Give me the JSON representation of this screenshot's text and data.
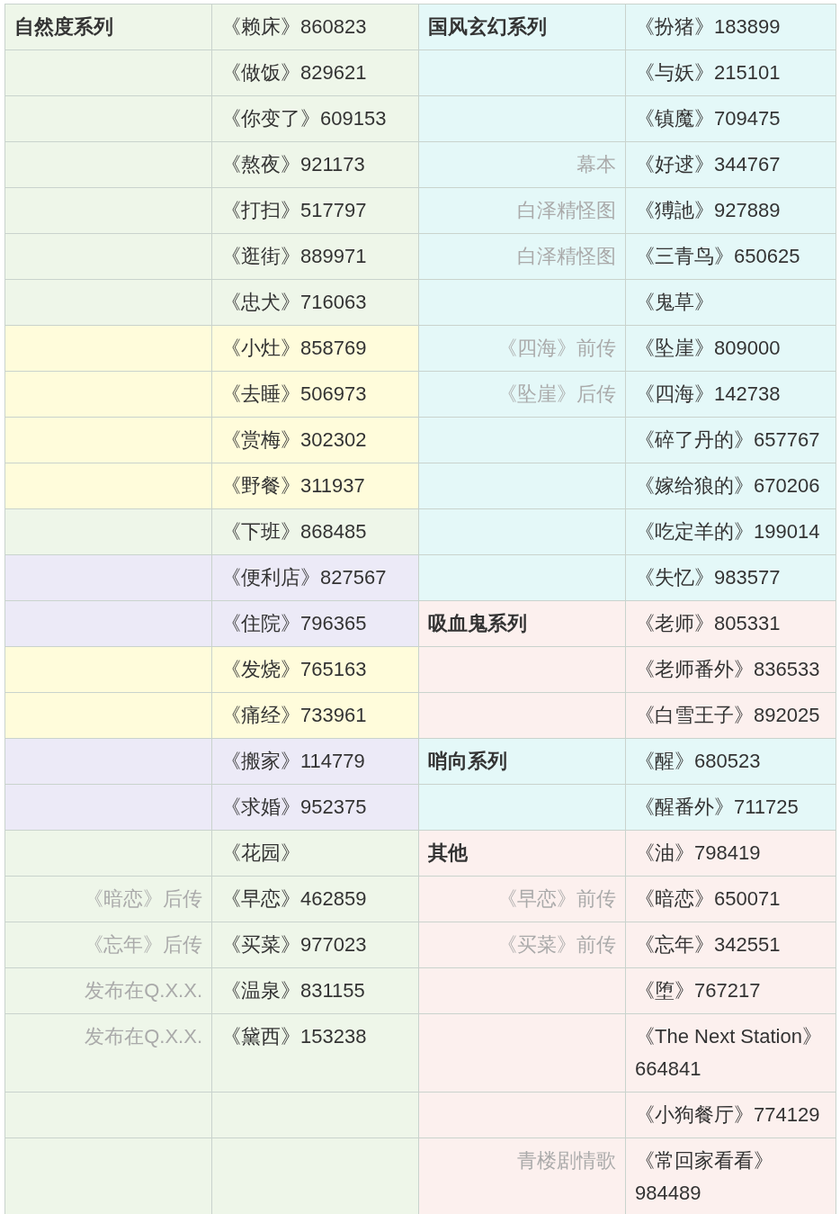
{
  "rows": [
    {
      "left": {
        "color": "#eef6e9",
        "label": {
          "text": "自然度系列",
          "kind": "series"
        },
        "title": "《赖床》860823"
      },
      "right": {
        "color": "#e4f8f8",
        "label": {
          "text": "国风玄幻系列",
          "kind": "series"
        },
        "title": "《扮猪》183899"
      }
    },
    {
      "left": {
        "color": "#eef6e9",
        "title": "《做饭》829621"
      },
      "right": {
        "color": "#e4f8f8",
        "title": "《与妖》215101"
      }
    },
    {
      "left": {
        "color": "#eef6e9",
        "title": "《你变了》609153"
      },
      "right": {
        "color": "#e4f8f8",
        "title": "《镇魔》709475"
      }
    },
    {
      "left": {
        "color": "#eef6e9",
        "title": "《熬夜》921173"
      },
      "right": {
        "color": "#e4f8f8",
        "label": {
          "text": "幕本",
          "kind": "note"
        },
        "title": "《好逑》344767"
      }
    },
    {
      "left": {
        "color": "#eef6e9",
        "title": "《打扫》517797"
      },
      "right": {
        "color": "#e4f8f8",
        "label": {
          "text": "白泽精怪图",
          "kind": "note"
        },
        "title": "《猼訑》927889"
      }
    },
    {
      "left": {
        "color": "#eef6e9",
        "title": "《逛街》889971"
      },
      "right": {
        "color": "#e4f8f8",
        "label": {
          "text": "白泽精怪图",
          "kind": "note"
        },
        "title": "《三青鸟》650625"
      }
    },
    {
      "left": {
        "color": "#eef6e9",
        "title": "《忠犬》716063"
      },
      "right": {
        "color": "#e4f8f8",
        "title": "《鬼草》"
      }
    },
    {
      "left": {
        "color": "#fffcdb",
        "title": "《小灶》858769"
      },
      "right": {
        "color": "#e4f8f8",
        "label": {
          "text": "《四海》前传",
          "kind": "note"
        },
        "title": "《坠崖》809000"
      }
    },
    {
      "left": {
        "color": "#fffcdb",
        "title": "《去睡》506973"
      },
      "right": {
        "color": "#e4f8f8",
        "label": {
          "text": "《坠崖》后传",
          "kind": "note"
        },
        "title": "《四海》142738"
      }
    },
    {
      "left": {
        "color": "#fffcdb",
        "title": "《赏梅》302302"
      },
      "right": {
        "color": "#e4f8f8",
        "title": "《碎了丹的》657767"
      }
    },
    {
      "left": {
        "color": "#fffcdb",
        "title": "《野餐》311937"
      },
      "right": {
        "color": "#e4f8f8",
        "title": "《嫁给狼的》670206"
      }
    },
    {
      "left": {
        "color": "#eef6e9",
        "title": "《下班》868485"
      },
      "right": {
        "color": "#e4f8f8",
        "title": "《吃定羊的》199014"
      }
    },
    {
      "left": {
        "color": "#eceaf7",
        "title": "《便利店》827567"
      },
      "right": {
        "color": "#e4f8f8",
        "title": "《失忆》983577"
      }
    },
    {
      "left": {
        "color": "#eceaf7",
        "title": "《住院》796365"
      },
      "right": {
        "color": "#fcf0ee",
        "label": {
          "text": "吸血鬼系列",
          "kind": "series"
        },
        "title": "《老师》805331"
      }
    },
    {
      "left": {
        "color": "#fffcdb",
        "title": "《发烧》765163"
      },
      "right": {
        "color": "#fcf0ee",
        "title": "《老师番外》836533"
      }
    },
    {
      "left": {
        "color": "#fffcdb",
        "title": "《痛经》733961"
      },
      "right": {
        "color": "#fcf0ee",
        "title": "《白雪王子》892025"
      }
    },
    {
      "left": {
        "color": "#eceaf7",
        "title": "《搬家》114779"
      },
      "right": {
        "color": "#e4f8f8",
        "label": {
          "text": "哨向系列",
          "kind": "series"
        },
        "title": "《醒》680523"
      }
    },
    {
      "left": {
        "color": "#eceaf7",
        "title": "《求婚》952375"
      },
      "right": {
        "color": "#e4f8f8",
        "title": "《醒番外》711725"
      }
    },
    {
      "left": {
        "color": "#eef6e9",
        "title": "《花园》"
      },
      "right": {
        "color": "#fcf0ee",
        "label": {
          "text": "其他",
          "kind": "series"
        },
        "title": "《油》798419"
      }
    },
    {
      "left": {
        "color": "#eef6e9",
        "label": {
          "text": "《暗恋》后传",
          "kind": "note"
        },
        "title": "《早恋》462859"
      },
      "right": {
        "color": "#fcf0ee",
        "label": {
          "text": "《早恋》前传",
          "kind": "note"
        },
        "title": "《暗恋》650071"
      }
    },
    {
      "left": {
        "color": "#eef6e9",
        "label": {
          "text": "《忘年》后传",
          "kind": "note"
        },
        "title": "《买菜》977023"
      },
      "right": {
        "color": "#fcf0ee",
        "label": {
          "text": "《买菜》前传",
          "kind": "note"
        },
        "title": "《忘年》342551"
      }
    },
    {
      "left": {
        "color": "#eef6e9",
        "label": {
          "text": "发布在Q.X.X.",
          "kind": "note"
        },
        "title": "《温泉》831155"
      },
      "right": {
        "color": "#fcf0ee",
        "title": "《堕》767217"
      }
    },
    {
      "left": {
        "color": "#eef6e9",
        "label": {
          "text": "发布在Q.X.X.",
          "kind": "note"
        },
        "title": "《黛西》153238"
      },
      "right": {
        "color": "#fcf0ee",
        "title": "《The Next Station》664841"
      }
    },
    {
      "left": {
        "color": "#eef6e9"
      },
      "right": {
        "color": "#fcf0ee",
        "title": "《小狗餐厅》774129"
      }
    },
    {
      "left": {
        "color": "#eef6e9"
      },
      "right": {
        "color": "#fcf0ee",
        "label": {
          "text": "青楼剧情歌",
          "kind": "note"
        },
        "title": "《常回家看看》984489"
      }
    }
  ]
}
